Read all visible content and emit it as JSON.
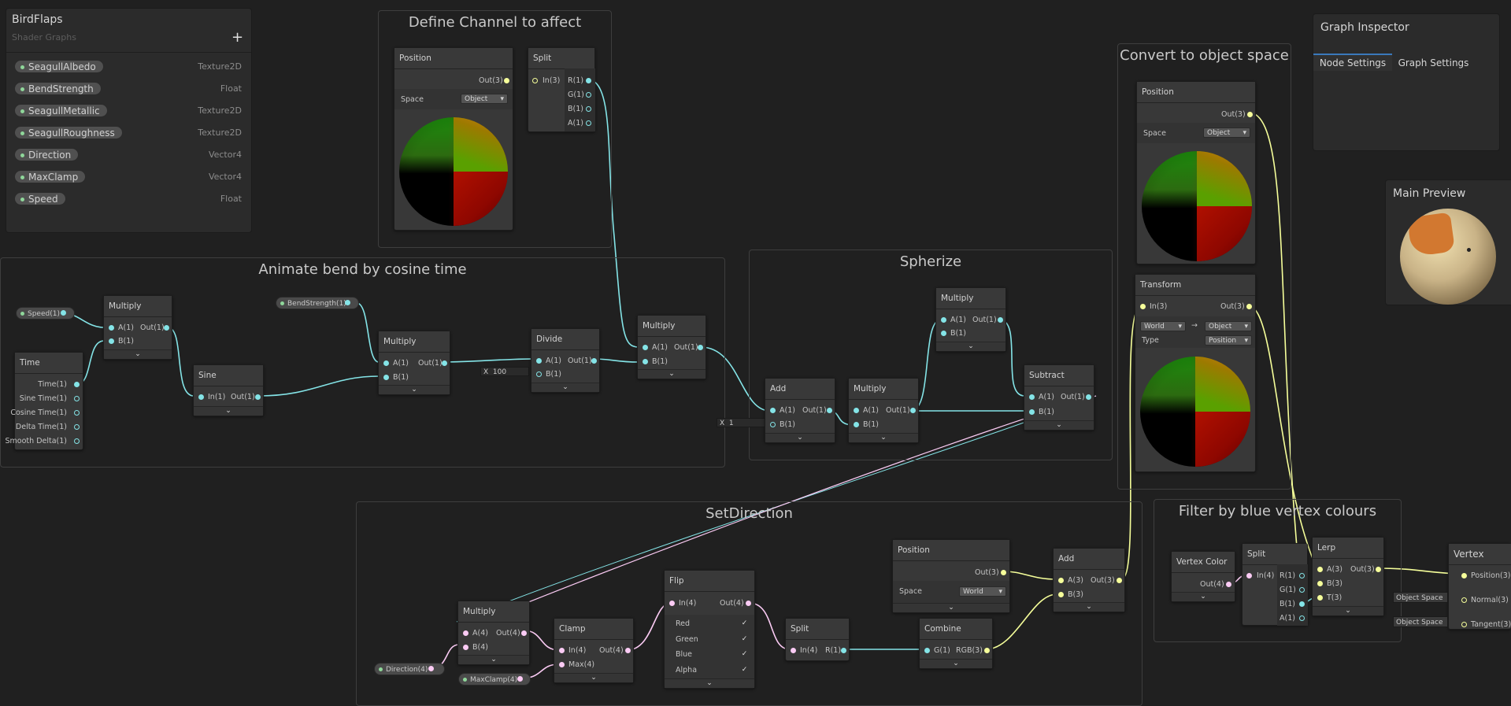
{
  "blackboard": {
    "title": "BirdFlaps",
    "subtitle": "Shader Graphs",
    "add_label": "+",
    "properties": [
      {
        "name": "SeagullAlbedo",
        "type": "Texture2D"
      },
      {
        "name": "BendStrength",
        "type": "Float"
      },
      {
        "name": "SeagullMetallic",
        "type": "Texture2D"
      },
      {
        "name": "SeagullRoughness",
        "type": "Texture2D"
      },
      {
        "name": "Direction",
        "type": "Vector4"
      },
      {
        "name": "MaxClamp",
        "type": "Vector4"
      },
      {
        "name": "Speed",
        "type": "Float"
      }
    ]
  },
  "inspector": {
    "title": "Graph Inspector",
    "tabs": [
      "Node Settings",
      "Graph Settings"
    ]
  },
  "main_preview": {
    "title": "Main Preview"
  },
  "groups": {
    "define_channel": "Define Channel to affect",
    "animate_bend": "Animate bend by cosine time",
    "spherize": "Spherize",
    "convert_space": "Convert to object space",
    "set_direction": "SetDirection",
    "filter_blue": "Filter by blue vertex colours"
  },
  "nodes": {
    "position1": {
      "title": "Position",
      "out": "Out(3)",
      "space_label": "Space",
      "space_value": "Object"
    },
    "split1": {
      "title": "Split",
      "in": "In(3)",
      "outs": [
        "R(1)",
        "G(1)",
        "B(1)",
        "A(1)"
      ]
    },
    "speed_prop": "Speed(1)",
    "time": {
      "title": "Time",
      "outs": [
        "Time(1)",
        "Sine Time(1)",
        "Cosine Time(1)",
        "Delta Time(1)",
        "Smooth Delta(1)"
      ]
    },
    "multiply1": {
      "title": "Multiply",
      "a": "A(1)",
      "b": "B(1)",
      "out": "Out(1)"
    },
    "sine": {
      "title": "Sine",
      "in": "In(1)",
      "out": "Out(1)"
    },
    "bend_prop": "BendStrength(1)",
    "multiply2": {
      "title": "Multiply",
      "a": "A(1)",
      "b": "B(1)",
      "out": "Out(1)"
    },
    "divide": {
      "title": "Divide",
      "a": "A(1)",
      "b": "B(1)",
      "out": "Out(1)",
      "b_field_label": "X",
      "b_field_value": "100"
    },
    "multiply3": {
      "title": "Multiply",
      "a": "A(1)",
      "b": "B(1)",
      "out": "Out(1)"
    },
    "add1": {
      "title": "Add",
      "a": "A(1)",
      "b": "B(1)",
      "out": "Out(1)",
      "b_field_label": "X",
      "b_field_value": "1"
    },
    "multiply4": {
      "title": "Multiply",
      "a": "A(1)",
      "b": "B(1)",
      "out": "Out(1)"
    },
    "multiply5": {
      "title": "Multiply",
      "a": "A(1)",
      "b": "B(1)",
      "out": "Out(1)"
    },
    "subtract": {
      "title": "Subtract",
      "a": "A(1)",
      "b": "B(1)",
      "out": "Out(1)"
    },
    "position2": {
      "title": "Position",
      "out": "Out(3)",
      "space_label": "Space",
      "space_value": "Object"
    },
    "transform": {
      "title": "Transform",
      "in": "In(3)",
      "out": "Out(3)",
      "from": "World",
      "arrow": "→",
      "to": "Object",
      "type_label": "Type",
      "type_value": "Position"
    },
    "multiply6": {
      "title": "Multiply",
      "a": "A(4)",
      "b": "B(4)",
      "out": "Out(4)"
    },
    "direction_prop": "Direction(4)",
    "maxclamp_prop": "MaxClamp(4)",
    "clamp": {
      "title": "Clamp",
      "in": "In(4)",
      "max": "Max(4)",
      "out": "Out(4)"
    },
    "flip": {
      "title": "Flip",
      "in": "In(4)",
      "out": "Out(4)",
      "options": [
        "Red",
        "Green",
        "Blue",
        "Alpha"
      ],
      "check": "✓"
    },
    "split2": {
      "title": "Split",
      "in": "In(4)",
      "out": "R(1)"
    },
    "position3": {
      "title": "Position",
      "out": "Out(3)",
      "space_label": "Space",
      "space_value": "World"
    },
    "combine": {
      "title": "Combine",
      "in": "G(1)",
      "out": "RGB(3)"
    },
    "add2": {
      "title": "Add",
      "a": "A(3)",
      "b": "B(3)",
      "out": "Out(3)"
    },
    "vertex_color": {
      "title": "Vertex Color",
      "out": "Out(4)"
    },
    "split3": {
      "title": "Split",
      "in": "In(4)",
      "outs": [
        "R(1)",
        "G(1)",
        "B(1)",
        "A(1)"
      ]
    },
    "lerp": {
      "title": "Lerp",
      "ins": [
        "A(3)",
        "B(3)",
        "T(3)"
      ],
      "out": "Out(3)"
    },
    "vertex": {
      "title": "Vertex",
      "ports": [
        "Position(3)",
        "Normal(3)",
        "Tangent(3)"
      ],
      "normal_space": "Object Space",
      "tangent_space": "Object Space"
    }
  },
  "colors": {
    "float_wire": "#84e4e7",
    "vector3_wire": "#f6ff9a",
    "vector4_wire": "#fbcbf4",
    "background": "#202020"
  },
  "icons": {
    "collapse": "chevron-down-icon",
    "add": "plus-icon"
  },
  "chevron": "⌄"
}
